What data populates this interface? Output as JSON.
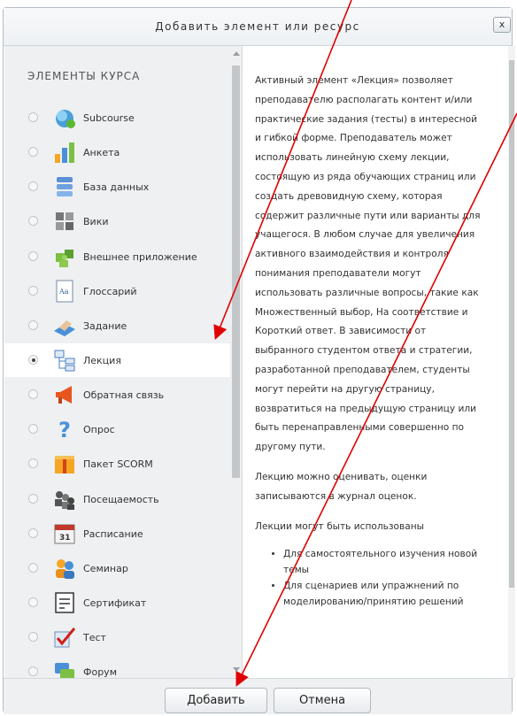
{
  "dialog": {
    "title": "Добавить элемент или ресурс",
    "close_label": "x"
  },
  "list": {
    "section_title": "ЭЛЕМЕНТЫ КУРСА",
    "items": [
      {
        "label": "Subcourse",
        "icon": "subcourse-icon"
      },
      {
        "label": "Анкета",
        "icon": "survey-chart-icon"
      },
      {
        "label": "База данных",
        "icon": "database-icon"
      },
      {
        "label": "Вики",
        "icon": "wiki-icon"
      },
      {
        "label": "Внешнее приложение",
        "icon": "puzzle-icon"
      },
      {
        "label": "Глоссарий",
        "icon": "glossary-icon"
      },
      {
        "label": "Задание",
        "icon": "assignment-icon"
      },
      {
        "label": "Лекция",
        "icon": "lesson-icon",
        "selected": true
      },
      {
        "label": "Обратная связь",
        "icon": "megaphone-icon"
      },
      {
        "label": "Опрос",
        "icon": "question-icon"
      },
      {
        "label": "Пакет SCORM",
        "icon": "scorm-package-icon"
      },
      {
        "label": "Посещаемость",
        "icon": "attendance-icon"
      },
      {
        "label": "Расписание",
        "icon": "calendar-icon"
      },
      {
        "label": "Семинар",
        "icon": "workshop-icon"
      },
      {
        "label": "Сертификат",
        "icon": "certificate-icon"
      },
      {
        "label": "Тест",
        "icon": "quiz-checkmark-icon"
      },
      {
        "label": "Форум",
        "icon": "forum-icon"
      }
    ]
  },
  "description": {
    "p1": "Активный элемент «Лекция» позволяет преподавателю располагать контент и/или практические задания (тесты) в интересной и гибкой форме. Преподаватель может использовать линейную схему лекции, состоящую из ряда обучающих страниц или создать древовидную схему, которая содержит различные пути или варианты для учащегося. В любом случае для увеличения активного взаимодействия и контроля понимания преподаватели могут использовать различные вопросы, такие как Множественный выбор, На соответствие и Короткий ответ. В зависимости от выбранного студентом ответа и стратегии, разработанной преподавателем, студенты могут перейти на другую страницу, возвратиться на предыдущую страницу или быть перенаправленными совершенно по другому пути.",
    "p2": "Лекцию можно оценивать, оценки записываются в журнал оценок.",
    "p3": "Лекции могут быть использованы",
    "bullets": [
      "Для самостоятельного изучения новой темы",
      "Для сценариев или упражнений по моделированию/принятию решений"
    ]
  },
  "footer": {
    "add_label": "Добавить",
    "cancel_label": "Отмена"
  },
  "colors": {
    "annotation_arrow": "#e00000",
    "panel_bg": "#eef0f2"
  }
}
